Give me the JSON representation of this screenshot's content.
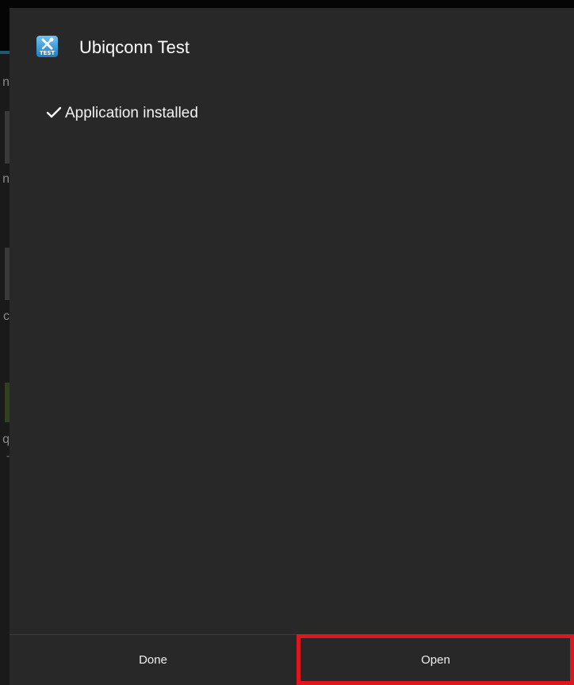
{
  "dialog": {
    "title": "Ubiqconn Test",
    "app_icon_text": "TEST",
    "status_text": "Application installed",
    "buttons": {
      "done_label": "Done",
      "open_label": "Open"
    }
  },
  "background": {
    "peek_glyphs": [
      "n",
      "n",
      "c",
      "q",
      "-"
    ]
  },
  "colors": {
    "dialog_background": "#282828",
    "highlight": "#e0161f",
    "text": "#ffffff"
  }
}
